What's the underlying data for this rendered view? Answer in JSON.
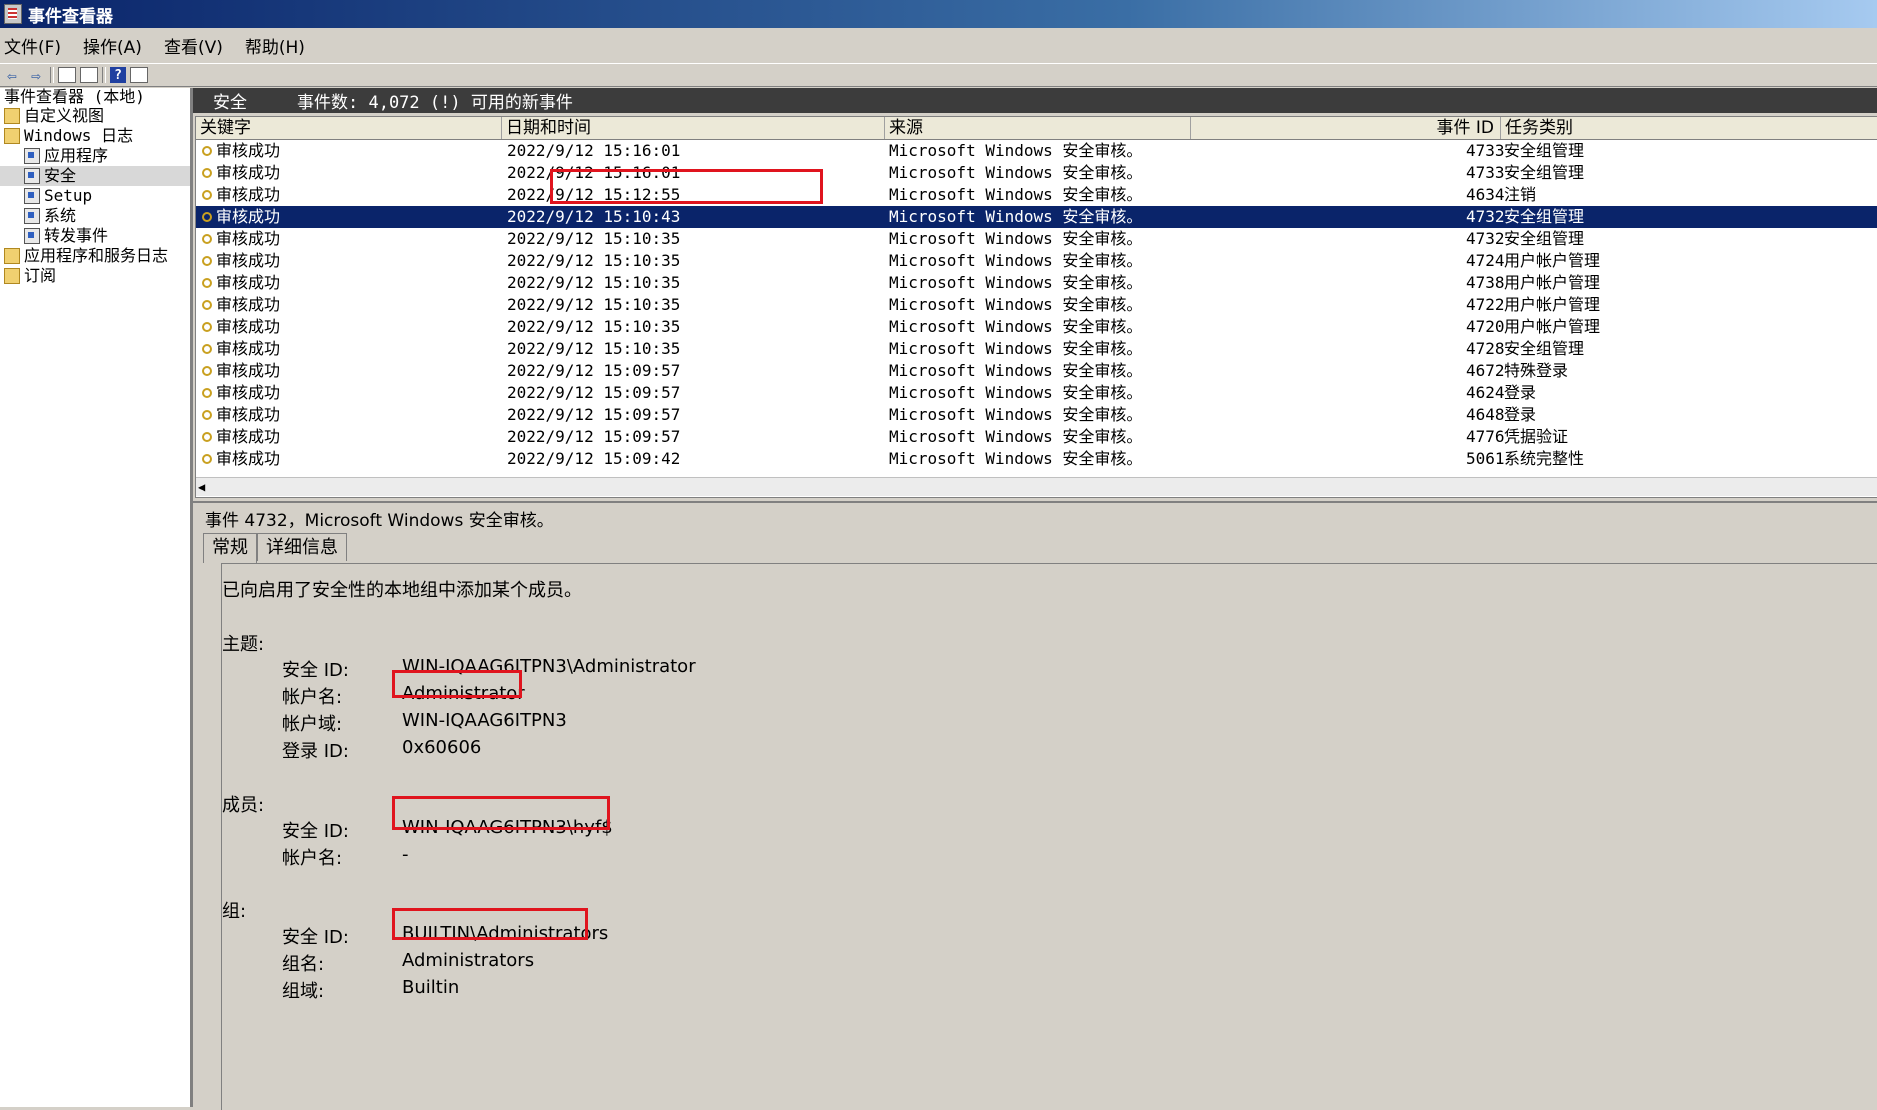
{
  "window": {
    "title": "事件查看器"
  },
  "menu": [
    "文件(F)",
    "操作(A)",
    "查看(V)",
    "帮助(H)"
  ],
  "tree": [
    {
      "label": "事件查看器 (本地)",
      "icon": "event-viewer-icon",
      "indent": 0
    },
    {
      "label": "自定义视图",
      "icon": "folder-icon",
      "indent": 0
    },
    {
      "label": "Windows 日志",
      "icon": "folder-icon",
      "indent": 0
    },
    {
      "label": "应用程序",
      "icon": "log-icon",
      "indent": 1
    },
    {
      "label": "安全",
      "icon": "log-icon",
      "indent": 1,
      "selected": true
    },
    {
      "label": "Setup",
      "icon": "log-icon",
      "indent": 1
    },
    {
      "label": "系统",
      "icon": "log-icon",
      "indent": 1
    },
    {
      "label": "转发事件",
      "icon": "log-icon",
      "indent": 1
    },
    {
      "label": "应用程序和服务日志",
      "icon": "folder-icon",
      "indent": 0
    },
    {
      "label": "订阅",
      "icon": "subscription-icon",
      "indent": 0
    }
  ],
  "pane_header": {
    "name": "安全",
    "summary": "事件数: 4,072 (!) 可用的新事件"
  },
  "columns": [
    "关键字",
    "日期和时间",
    "来源",
    "事件 ID",
    "任务类别"
  ],
  "events": [
    {
      "keyword": "审核成功",
      "datetime": "2022/9/12 15:16:01",
      "source": "Microsoft Windows 安全审核。",
      "id": "4733",
      "task": "安全组管理"
    },
    {
      "keyword": "审核成功",
      "datetime": "2022/9/12 15:16:01",
      "source": "Microsoft Windows 安全审核。",
      "id": "4733",
      "task": "安全组管理"
    },
    {
      "keyword": "审核成功",
      "datetime": "2022/9/12 15:12:55",
      "source": "Microsoft Windows 安全审核。",
      "id": "4634",
      "task": "注销"
    },
    {
      "keyword": "审核成功",
      "datetime": "2022/9/12 15:10:43",
      "source": "Microsoft Windows 安全审核。",
      "id": "4732",
      "task": "安全组管理",
      "selected": true
    },
    {
      "keyword": "审核成功",
      "datetime": "2022/9/12 15:10:35",
      "source": "Microsoft Windows 安全审核。",
      "id": "4732",
      "task": "安全组管理"
    },
    {
      "keyword": "审核成功",
      "datetime": "2022/9/12 15:10:35",
      "source": "Microsoft Windows 安全审核。",
      "id": "4724",
      "task": "用户帐户管理"
    },
    {
      "keyword": "审核成功",
      "datetime": "2022/9/12 15:10:35",
      "source": "Microsoft Windows 安全审核。",
      "id": "4738",
      "task": "用户帐户管理"
    },
    {
      "keyword": "审核成功",
      "datetime": "2022/9/12 15:10:35",
      "source": "Microsoft Windows 安全审核。",
      "id": "4722",
      "task": "用户帐户管理"
    },
    {
      "keyword": "审核成功",
      "datetime": "2022/9/12 15:10:35",
      "source": "Microsoft Windows 安全审核。",
      "id": "4720",
      "task": "用户帐户管理"
    },
    {
      "keyword": "审核成功",
      "datetime": "2022/9/12 15:10:35",
      "source": "Microsoft Windows 安全审核。",
      "id": "4728",
      "task": "安全组管理"
    },
    {
      "keyword": "审核成功",
      "datetime": "2022/9/12 15:09:57",
      "source": "Microsoft Windows 安全审核。",
      "id": "4672",
      "task": "特殊登录"
    },
    {
      "keyword": "审核成功",
      "datetime": "2022/9/12 15:09:57",
      "source": "Microsoft Windows 安全审核。",
      "id": "4624",
      "task": "登录"
    },
    {
      "keyword": "审核成功",
      "datetime": "2022/9/12 15:09:57",
      "source": "Microsoft Windows 安全审核。",
      "id": "4648",
      "task": "登录"
    },
    {
      "keyword": "审核成功",
      "datetime": "2022/9/12 15:09:57",
      "source": "Microsoft Windows 安全审核。",
      "id": "4776",
      "task": "凭据验证"
    },
    {
      "keyword": "审核成功",
      "datetime": "2022/9/12 15:09:42",
      "source": "Microsoft Windows 安全审核。",
      "id": "5061",
      "task": "系统完整性"
    }
  ],
  "detail": {
    "title": "事件 4732，Microsoft Windows 安全审核。",
    "tabs": [
      "常规",
      "详细信息"
    ],
    "description": "已向启用了安全性的本地组中添加某个成员。",
    "subject_heading": "主题:",
    "subject": [
      {
        "label": "安全 ID:",
        "value": "WIN-IQAAG6ITPN3\\Administrator"
      },
      {
        "label": "帐户名:",
        "value": "Administrator"
      },
      {
        "label": "帐户域:",
        "value": "WIN-IQAAG6ITPN3"
      },
      {
        "label": "登录 ID:",
        "value": "0x60606"
      }
    ],
    "member_heading": "成员:",
    "member": [
      {
        "label": "安全 ID:",
        "value": "WIN-IQAAG6ITPN3\\hyf$"
      },
      {
        "label": "帐户名:",
        "value": "-"
      }
    ],
    "group_heading": "组:",
    "group": [
      {
        "label": "安全 ID:",
        "value": "BUILTIN\\Administrators"
      },
      {
        "label": "组名:",
        "value": "Administrators"
      },
      {
        "label": "组域:",
        "value": "Builtin"
      }
    ]
  },
  "colors": {
    "selection": "#0a246a",
    "highlight_box": "#e0141e"
  }
}
